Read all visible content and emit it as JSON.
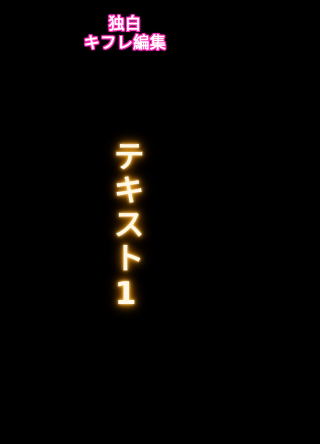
{
  "title": {
    "line1": "独白",
    "line2": "キフレ編集"
  },
  "main_text": "テキスト1",
  "colors": {
    "background": "#000000",
    "title_outline": "#ff2fb8",
    "main_glow": "#ffb733"
  }
}
